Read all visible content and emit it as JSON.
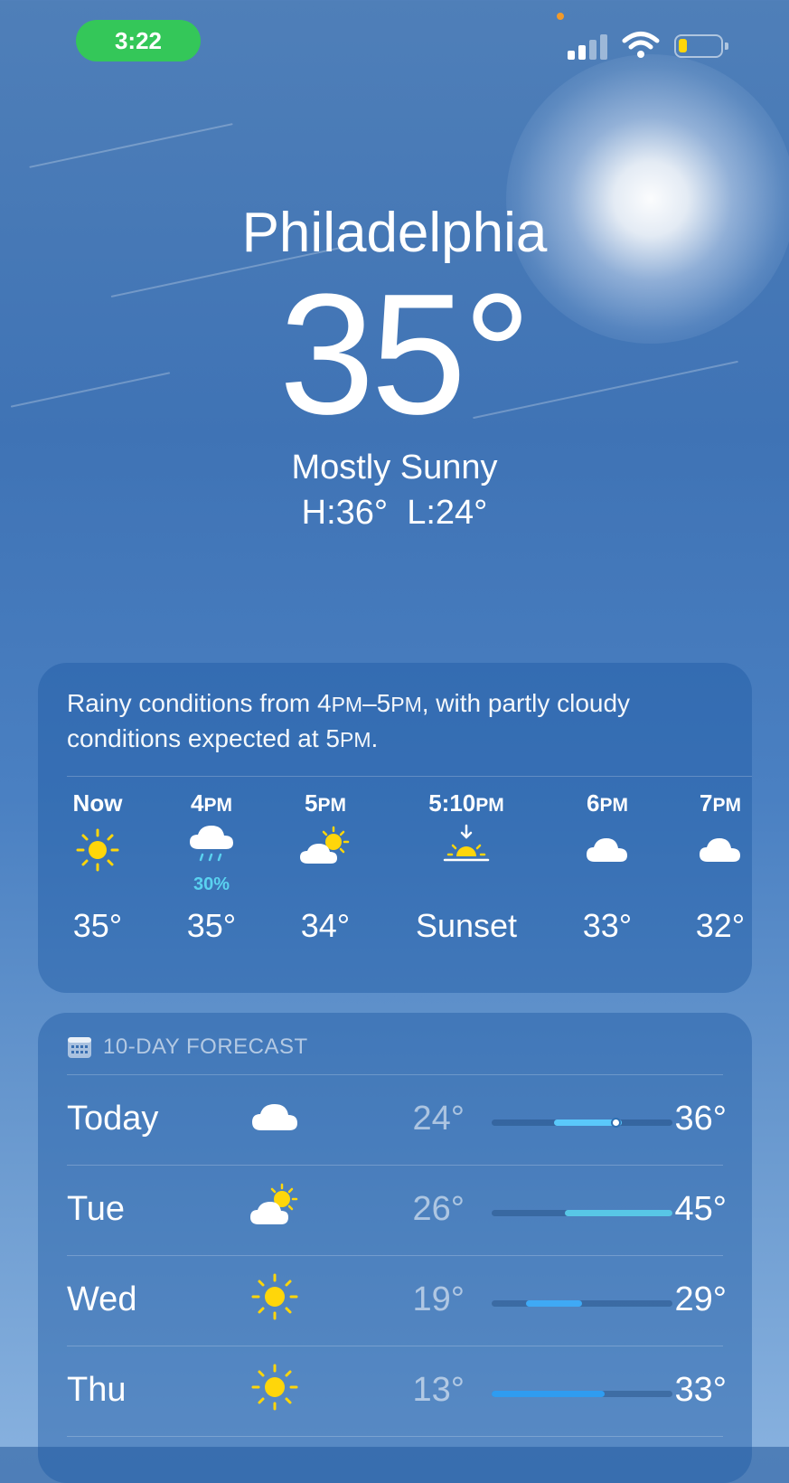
{
  "status_bar": {
    "time": "3:22",
    "signal_bars": 2,
    "battery_level": 0.2,
    "colors": {
      "time_pill": "#34c759",
      "battery": "#ffd60a",
      "camera_dot": "#f19a2a"
    }
  },
  "hero": {
    "city": "Philadelphia",
    "temperature": "35°",
    "condition": "Mostly Sunny",
    "high": "H:36°",
    "low": "L:24°"
  },
  "hourly": {
    "summary": {
      "part1": "Rainy conditions from 4",
      "pm1": "PM",
      "dash": "–5",
      "pm2": "PM",
      "part2": ", with partly cloudy conditions expected at 5",
      "pm3": "PM",
      "end": "."
    },
    "items": [
      {
        "label": "Now",
        "icon": "sun-icon",
        "temp": "35°"
      },
      {
        "label_num": "4",
        "label_suffix": "PM",
        "icon": "cloud-rain-icon",
        "precip": "30%",
        "temp": "35°"
      },
      {
        "label_num": "5",
        "label_suffix": "PM",
        "icon": "cloud-sun-icon",
        "temp": "34°"
      },
      {
        "label_num": "5:10",
        "label_suffix": "PM",
        "icon": "sunset-icon",
        "temp": "Sunset"
      },
      {
        "label_num": "6",
        "label_suffix": "PM",
        "icon": "cloud-icon",
        "temp": "33°"
      },
      {
        "label_num": "7",
        "label_suffix": "PM",
        "icon": "cloud-icon",
        "temp": "32°"
      }
    ]
  },
  "daily": {
    "title": "10-DAY FORECAST",
    "icon": "calendar-icon",
    "range_scale": {
      "min": 13,
      "max": 45
    },
    "rows": [
      {
        "day": "Today",
        "icon": "cloud-icon",
        "low": "24°",
        "high": "36°",
        "low_val": 24,
        "high_val": 36,
        "current_val": 35,
        "bar_color": "#5ac8fa"
      },
      {
        "day": "Tue",
        "icon": "cloud-sun-icon",
        "low": "26°",
        "high": "45°",
        "low_val": 26,
        "high_val": 45,
        "bar_color": "#58c6e6"
      },
      {
        "day": "Wed",
        "icon": "sun-icon",
        "low": "19°",
        "high": "29°",
        "low_val": 19,
        "high_val": 29,
        "bar_color": "#3fa9f5"
      },
      {
        "day": "Thu",
        "icon": "sun-icon",
        "low": "13°",
        "high": "33°",
        "low_val": 13,
        "high_val": 33,
        "bar_color": "#2f9cf0"
      }
    ]
  }
}
